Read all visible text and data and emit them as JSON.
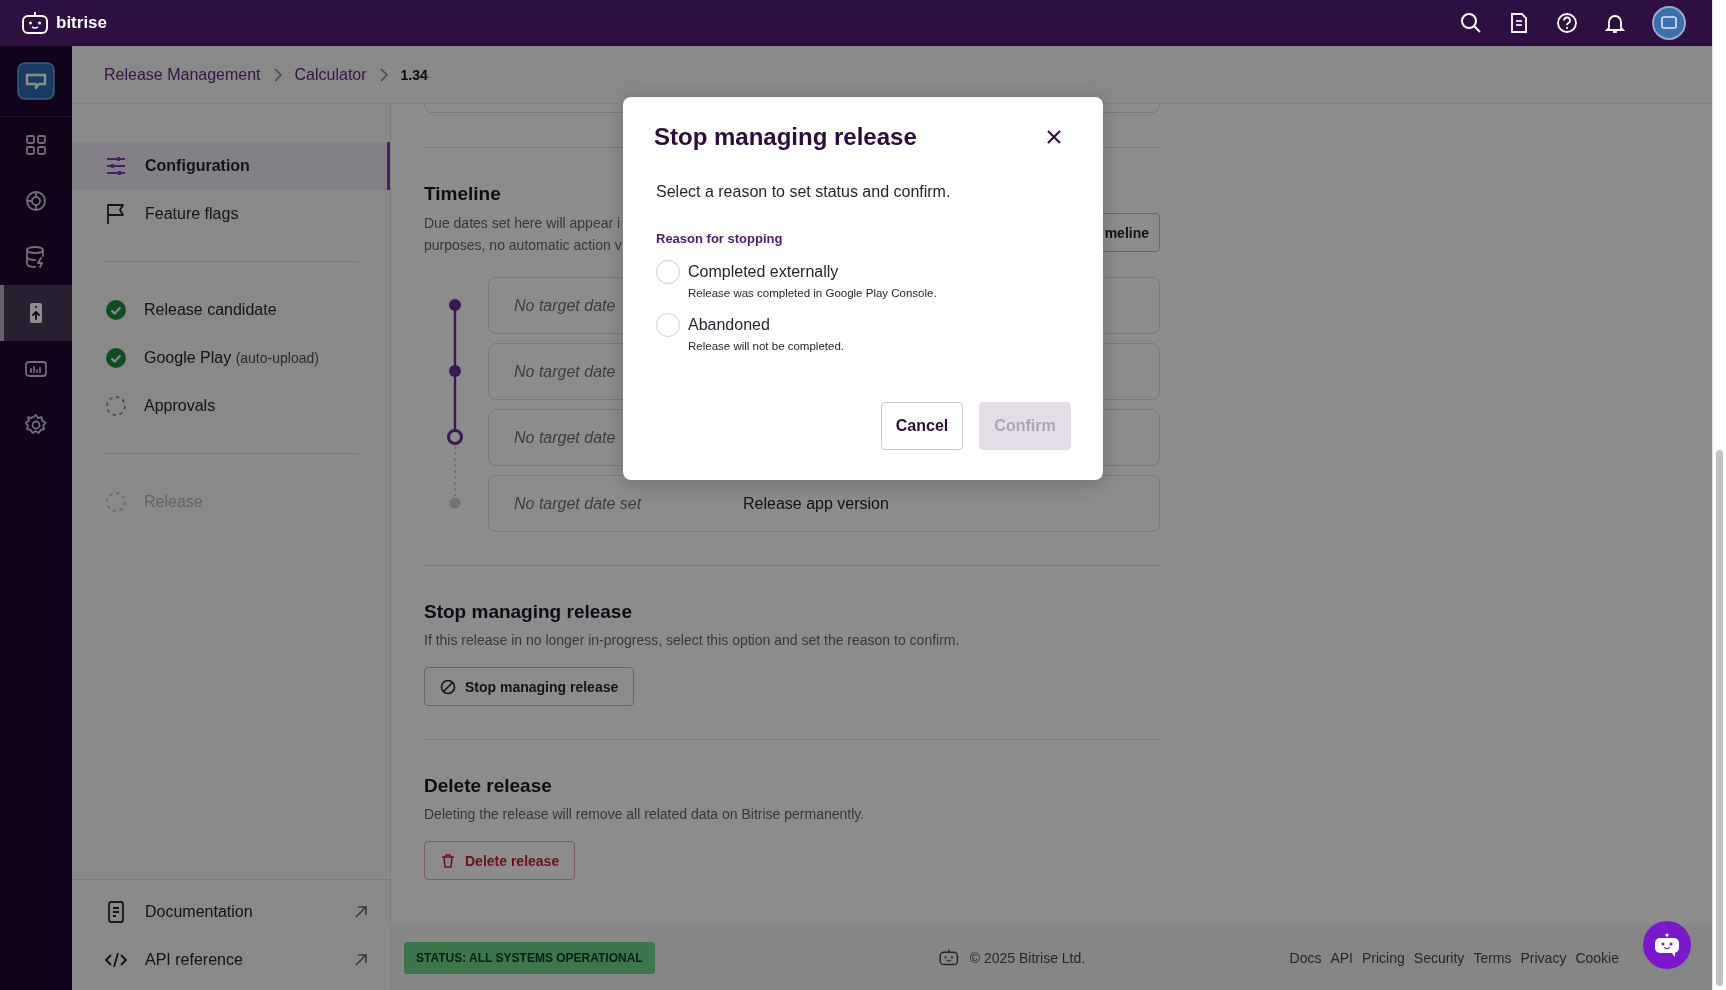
{
  "topbar": {
    "brand": "bitrise"
  },
  "rail": {
    "items": [
      {
        "selected": false
      },
      {
        "selected": false
      },
      {
        "selected": false
      },
      {
        "selected": true
      },
      {
        "selected": false
      },
      {
        "selected": false
      }
    ]
  },
  "breadcrumb": [
    {
      "label": "Release Management",
      "current": false
    },
    {
      "label": "Calculator",
      "current": false
    },
    {
      "label": "1.34",
      "current": true
    }
  ],
  "sidebar": {
    "nav": [
      {
        "label": "Configuration",
        "selected": true
      },
      {
        "label": "Feature flags",
        "selected": false
      }
    ],
    "steps": [
      {
        "label": "Release candidate",
        "done": true,
        "disabled": false
      },
      {
        "label": "Google Play",
        "note": "(auto-upload)",
        "done": true,
        "disabled": false
      },
      {
        "label": "Approvals",
        "done": false,
        "disabled": false
      }
    ],
    "final_steps": [
      {
        "label": "Release",
        "done": false,
        "disabled": true
      }
    ],
    "links": [
      {
        "label": "Documentation"
      },
      {
        "label": "API reference"
      }
    ]
  },
  "timeline": {
    "title": "Timeline",
    "description_lines": [
      "Due dates set here will appear i",
      "purposes, no automatic action v"
    ],
    "button": "meline",
    "rows": [
      {
        "date": "No target date",
        "done": true,
        "current": false
      },
      {
        "date": "No target date",
        "done": true,
        "current": false
      },
      {
        "date": "No target date",
        "done": false,
        "current": true
      },
      {
        "date": "No target date set",
        "step": "Release app version",
        "done": false,
        "current": false
      }
    ]
  },
  "stop_section": {
    "title": "Stop managing release",
    "description": "If this release in no longer in-progress, select this option and set the reason to confirm.",
    "button": "Stop managing release"
  },
  "delete_section": {
    "title": "Delete release",
    "description": "Deleting the release will remove all related data on Bitrise permanently.",
    "button": "Delete release"
  },
  "footer": {
    "status": "STATUS: ALL SYSTEMS OPERATIONAL",
    "copyright": "© 2025 Bitrise Ltd.",
    "links": [
      "Docs",
      "API",
      "Pricing",
      "Security",
      "Terms",
      "Privacy",
      "Cookie"
    ]
  },
  "modal": {
    "title": "Stop managing release",
    "subtitle": "Select a reason to set status and confirm.",
    "group_label": "Reason for stopping",
    "options": [
      {
        "label": "Completed externally",
        "hint": "Release was completed in Google Play Console.",
        "selected": false
      },
      {
        "label": "Abandoned",
        "hint": "Release will not be completed.",
        "selected": false
      }
    ],
    "buttons": [
      {
        "label": "Cancel",
        "kind": "secondary",
        "disabled": false
      },
      {
        "label": "Confirm",
        "kind": "primary",
        "disabled": true
      }
    ]
  }
}
